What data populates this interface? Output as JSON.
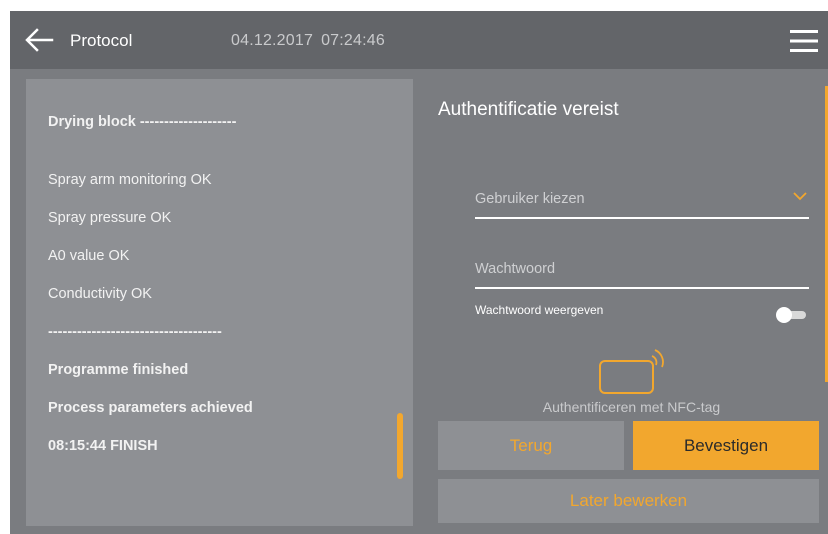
{
  "header": {
    "title": "Protocol",
    "date": "04.12.2017",
    "time": "07:24:46"
  },
  "protocol": {
    "lines": [
      "Drying block --------------------",
      "Spray arm monitoring OK",
      "Spray pressure OK",
      "A0 value OK",
      "Conductivity OK",
      "------------------------------------",
      "Programme finished",
      "Process parameters achieved",
      "08:15:44 FINISH"
    ]
  },
  "auth": {
    "title": "Authentificatie vereist",
    "user_placeholder": "Gebruiker kiezen",
    "password_placeholder": "Wachtwoord",
    "show_password_label": "Wachtwoord weergeven",
    "show_password_on": false,
    "nfc_label": "Authentificeren met NFC-tag",
    "back_label": "Terug",
    "confirm_label": "Bevestigen",
    "later_label": "Later bewerken"
  },
  "colors": {
    "accent": "#f2a72e",
    "header_bg": "#636569",
    "screen_bg": "#7a7c80",
    "panel_bg": "#8e9094"
  },
  "icons": {
    "back": "arrow-left-icon",
    "menu": "hamburger-menu-icon",
    "dropdown": "chevron-down-icon",
    "nfc": "nfc-tag-icon"
  }
}
